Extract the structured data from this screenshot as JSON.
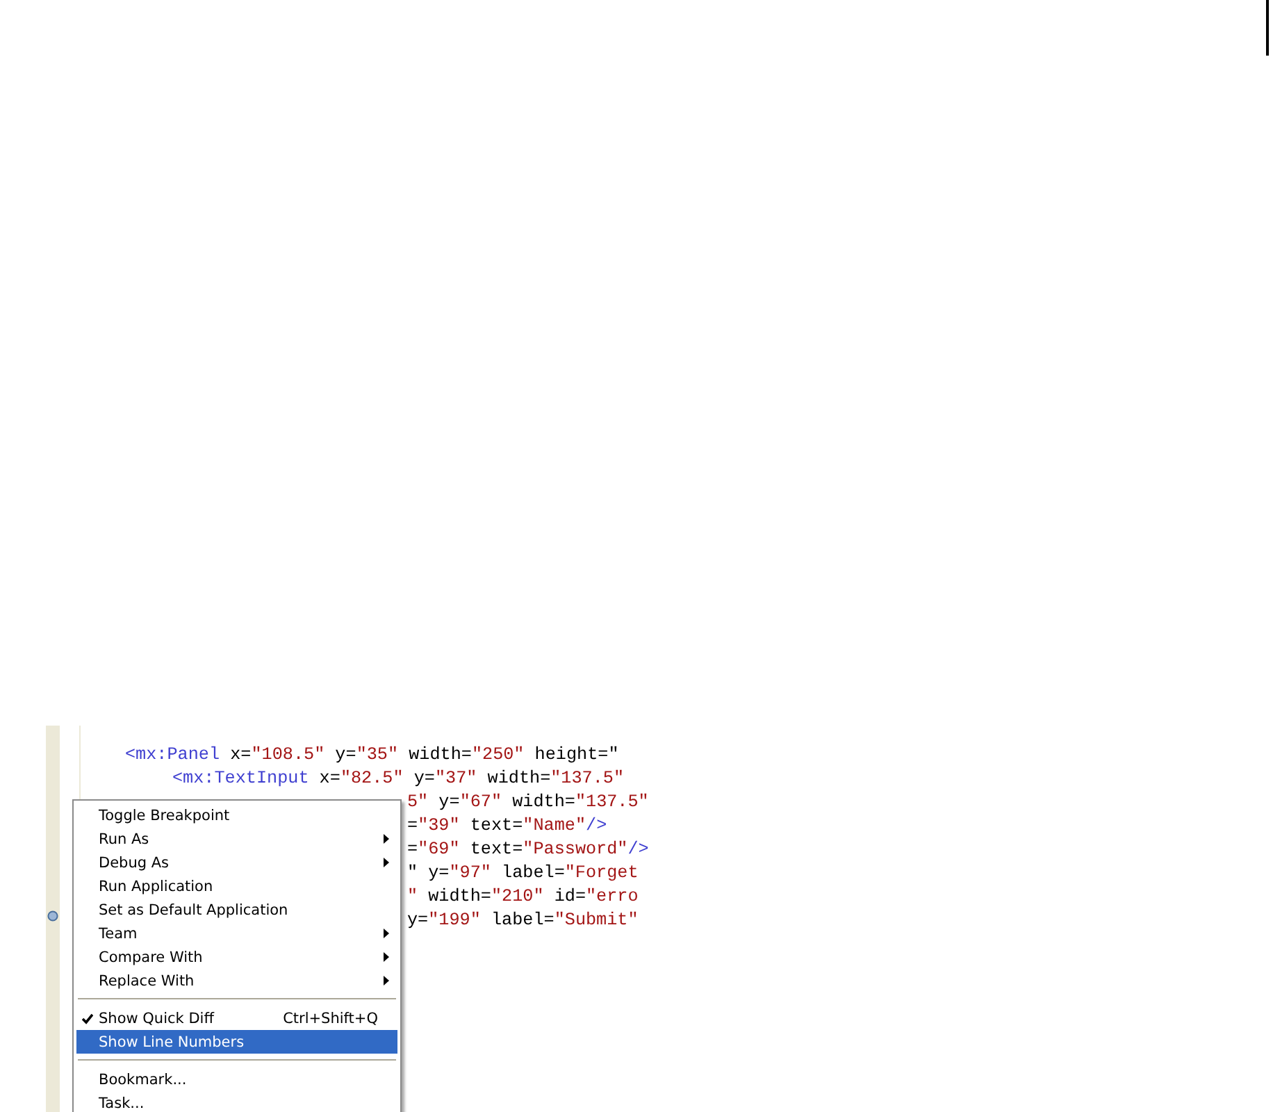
{
  "editor": {
    "lines": [
      {
        "tokens": [
          {
            "kind": "tag",
            "text": "<mx:Panel"
          },
          {
            "kind": "attr",
            "text": " x="
          },
          {
            "kind": "value",
            "text": "\"108.5\""
          },
          {
            "kind": "attr",
            "text": " y="
          },
          {
            "kind": "value",
            "text": "\"35\""
          },
          {
            "kind": "attr",
            "text": " width="
          },
          {
            "kind": "value",
            "text": "\"250\""
          },
          {
            "kind": "attr",
            "text": " height=\""
          }
        ],
        "children": [
          {
            "tokens": [
              {
                "kind": "tag",
                "text": "<mx:TextInput"
              },
              {
                "kind": "attr",
                "text": " x="
              },
              {
                "kind": "value",
                "text": "\"82.5\""
              },
              {
                "kind": "attr",
                "text": " y="
              },
              {
                "kind": "value",
                "text": "\"37\""
              },
              {
                "kind": "attr",
                "text": " width="
              },
              {
                "kind": "value",
                "text": "\"137.5\""
              }
            ]
          },
          {
            "kind": "covered",
            "tokens": [
              {
                "kind": "value",
                "text": "5\""
              },
              {
                "kind": "attr",
                "text": " y="
              },
              {
                "kind": "value",
                "text": "\"67\""
              },
              {
                "kind": "attr",
                "text": " width="
              },
              {
                "kind": "value",
                "text": "\"137.5\""
              }
            ]
          },
          {
            "kind": "covered",
            "tokens": [
              {
                "kind": "attr",
                "text": "="
              },
              {
                "kind": "value",
                "text": "\"39\""
              },
              {
                "kind": "attr",
                "text": " text="
              },
              {
                "kind": "value",
                "text": "\"Name\""
              },
              {
                "kind": "tag",
                "text": "/>"
              }
            ]
          },
          {
            "kind": "covered",
            "tokens": [
              {
                "kind": "attr",
                "text": "="
              },
              {
                "kind": "value",
                "text": "\"69\""
              },
              {
                "kind": "attr",
                "text": " text="
              },
              {
                "kind": "value",
                "text": "\"Password\""
              },
              {
                "kind": "tag",
                "text": "/>"
              }
            ]
          },
          {
            "kind": "covered",
            "tokens": [
              {
                "kind": "attr",
                "text": "\" y="
              },
              {
                "kind": "value",
                "text": "\"97\""
              },
              {
                "kind": "attr",
                "text": " label="
              },
              {
                "kind": "value",
                "text": "\"Forget"
              }
            ]
          },
          {
            "kind": "covered",
            "tokens": [
              {
                "kind": "value",
                "text": "\""
              },
              {
                "kind": "attr",
                "text": " width="
              },
              {
                "kind": "value",
                "text": "\"210\""
              },
              {
                "kind": "attr",
                "text": " id="
              },
              {
                "kind": "value",
                "text": "\"erro"
              }
            ]
          },
          {
            "kind": "covered",
            "tokens": [
              {
                "kind": "attr",
                "text": "y="
              },
              {
                "kind": "value",
                "text": "\"199\""
              },
              {
                "kind": "attr",
                "text": " label="
              },
              {
                "kind": "value",
                "text": "\"Submit\""
              }
            ]
          }
        ]
      }
    ]
  },
  "context_menu": {
    "items": [
      {
        "kind": "item",
        "label": "Toggle Breakpoint",
        "submenu": false
      },
      {
        "kind": "item",
        "label": "Run As",
        "submenu": true
      },
      {
        "kind": "item",
        "label": "Debug As",
        "submenu": true
      },
      {
        "kind": "item",
        "label": "Run Application",
        "submenu": false
      },
      {
        "kind": "item",
        "label": "Set as Default Application",
        "submenu": false
      },
      {
        "kind": "item",
        "label": "Team",
        "submenu": true
      },
      {
        "kind": "item",
        "label": "Compare With",
        "submenu": true
      },
      {
        "kind": "item",
        "label": "Replace With",
        "submenu": true
      },
      {
        "kind": "separator"
      },
      {
        "kind": "check",
        "label": "Show Quick Diff",
        "shortcut": "Ctrl+Shift+Q",
        "checked": true,
        "selected": false
      },
      {
        "kind": "check",
        "label": "Show Line Numbers",
        "checked": false,
        "selected": true
      },
      {
        "kind": "separator"
      },
      {
        "kind": "item",
        "label": "Bookmark...",
        "submenu": false
      },
      {
        "kind": "item",
        "label": "Task...",
        "submenu": false
      }
    ]
  }
}
